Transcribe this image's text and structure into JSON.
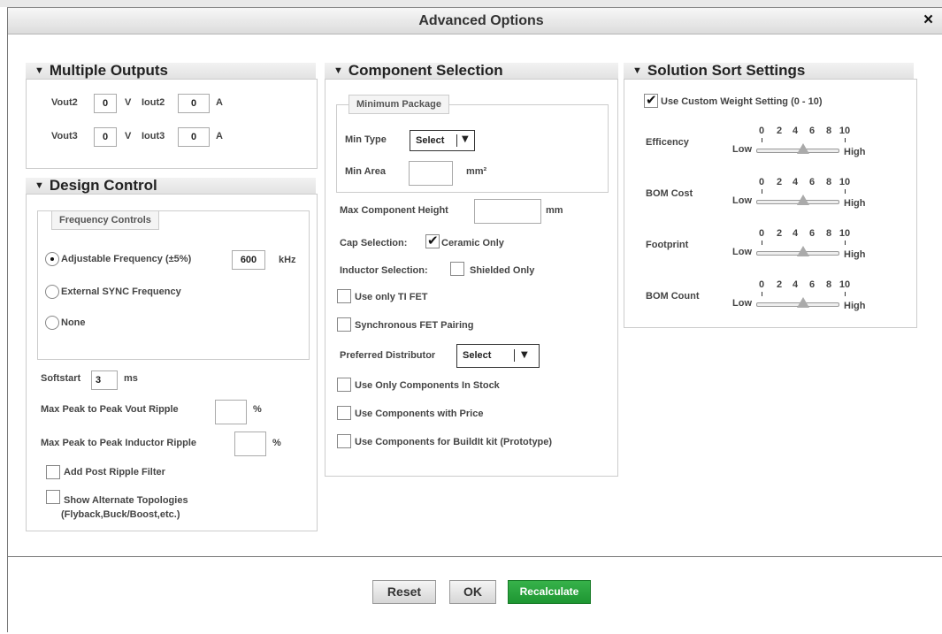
{
  "dialog": {
    "title": "Advanced Options",
    "close_glyph": "×"
  },
  "multiple_outputs": {
    "header": "Multiple Outputs",
    "rows": [
      {
        "v_label": "Vout2",
        "v_value": "0",
        "v_unit": "V",
        "i_label": "Iout2",
        "i_value": "0",
        "i_unit": "A"
      },
      {
        "v_label": "Vout3",
        "v_value": "0",
        "v_unit": "V",
        "i_label": "Iout3",
        "i_value": "0",
        "i_unit": "A"
      }
    ]
  },
  "design_control": {
    "header": "Design Control",
    "frequency_legend": "Frequency Controls",
    "adjustable_label": "Adjustable Frequency (±5%)",
    "adjustable_value": "600",
    "adjustable_unit": "kHz",
    "external_sync_label": "External SYNC Frequency",
    "none_label": "None",
    "selected_frequency_mode": "adjustable",
    "softstart_label": "Softstart",
    "softstart_value": "3",
    "softstart_unit": "ms",
    "vout_ripple_label": "Max Peak to Peak Vout Ripple",
    "vout_ripple_value": "",
    "vout_ripple_unit": "%",
    "inductor_ripple_label": "Max Peak to Peak Inductor Ripple",
    "inductor_ripple_value": "",
    "inductor_ripple_unit": "%",
    "post_ripple_filter_label": "Add Post Ripple Filter",
    "post_ripple_filter_checked": false,
    "alt_topologies_line1": "Show Alternate Topologies",
    "alt_topologies_line2": "(Flyback,Buck/Boost,etc.)",
    "alt_topologies_checked": false
  },
  "component_selection": {
    "header": "Component Selection",
    "min_package_legend": "Minimum Package",
    "min_type_label": "Min Type",
    "min_type_value": "Select",
    "min_area_label": "Min Area",
    "min_area_value": "",
    "min_area_unit": "mm²",
    "max_height_label": "Max Component Height",
    "max_height_value": "",
    "max_height_unit": "mm",
    "cap_selection_label": "Cap Selection:",
    "ceramic_only_label": "Ceramic Only",
    "ceramic_only_checked": true,
    "inductor_selection_label": "Inductor Selection:",
    "shielded_only_label": "Shielded Only",
    "shielded_only_checked": false,
    "ti_fet_label": "Use only TI FET",
    "ti_fet_checked": false,
    "sync_fet_label": "Synchronous FET Pairing",
    "sync_fet_checked": false,
    "distributor_label": "Preferred Distributor",
    "distributor_value": "Select",
    "in_stock_label": "Use Only Components In Stock",
    "in_stock_checked": false,
    "with_price_label": "Use Components with Price",
    "with_price_checked": false,
    "buildit_label": "Use Components for BuildIt kit (Prototype)",
    "buildit_checked": false
  },
  "solution_sort": {
    "header": "Solution Sort Settings",
    "custom_weight_label": "Use Custom Weight Setting (0 - 10)",
    "custom_weight_checked": true,
    "scale_numbers": [
      "0",
      "2",
      "4",
      "6",
      "8",
      "10"
    ],
    "low_label": "Low",
    "high_label": "High",
    "sliders": [
      {
        "label": "Efficency",
        "value": 5
      },
      {
        "label": "BOM Cost",
        "value": 5
      },
      {
        "label": "Footprint",
        "value": 5
      },
      {
        "label": "BOM Count",
        "value": 5
      }
    ]
  },
  "footer": {
    "reset_label": "Reset",
    "ok_label": "OK",
    "recalculate_label": "Recalculate"
  },
  "colors": {
    "recalculate_bg": "#1e9632",
    "header_bg": "#e6e6e6",
    "title_bg": "#dcdcdc"
  },
  "icons": {
    "section_toggle": "triangle-down-icon",
    "select_arrow": "chevron-down-icon",
    "close": "close-icon"
  }
}
